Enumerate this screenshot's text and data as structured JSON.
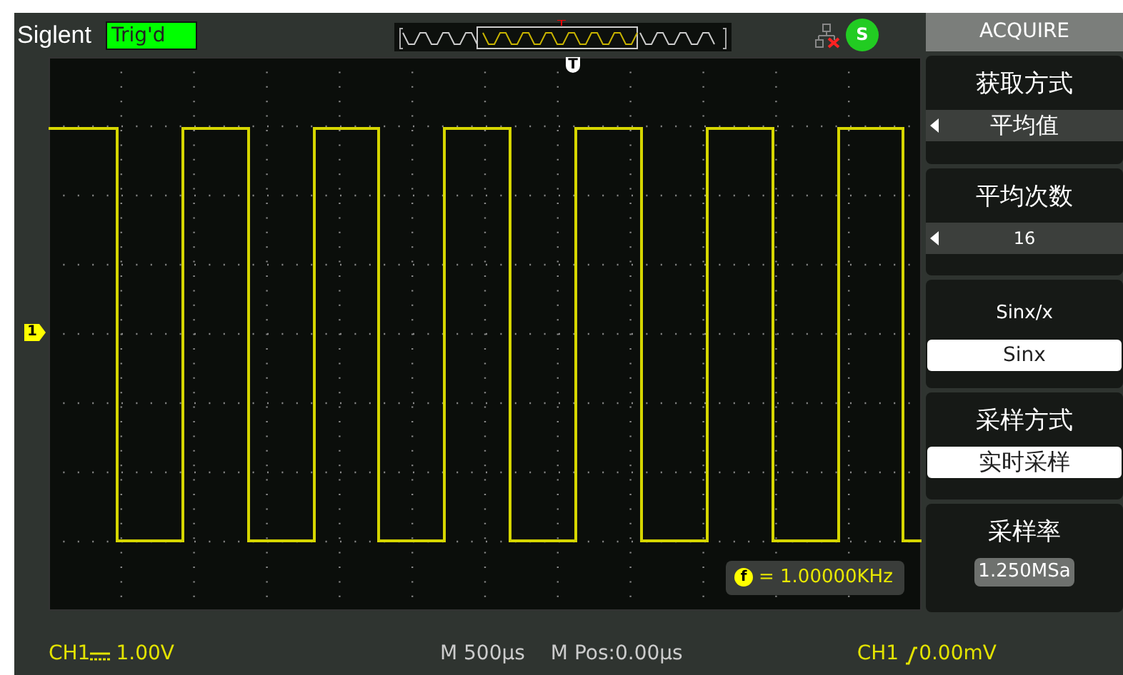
{
  "top_bar": {
    "brand": "Siglent",
    "trigger_status": "Trig'd",
    "status_badge": "S"
  },
  "markers": {
    "trigger_position": "T",
    "channel": "1"
  },
  "frequency": {
    "badge": "f",
    "reading": "= 1.00000KHz"
  },
  "menu": {
    "title": "ACQUIRE",
    "items": [
      {
        "kind": "selector",
        "label": "获取方式",
        "value": "平均值"
      },
      {
        "kind": "selector",
        "label": "平均次数",
        "value": "16"
      },
      {
        "kind": "option",
        "label": "Sinx/x",
        "value": "Sinx"
      },
      {
        "kind": "option",
        "label": "采样方式",
        "value": "实时采样"
      },
      {
        "kind": "readout",
        "label": "采样率",
        "value": "1.250MSa"
      }
    ]
  },
  "status_bar": {
    "channel_scale": {
      "channel": "CH1",
      "value": "1.00V"
    },
    "timebase": "M 500µs",
    "position": "M Pos:0.00µs",
    "trigger": {
      "channel": "CH1",
      "level": "0.00mV"
    }
  }
}
